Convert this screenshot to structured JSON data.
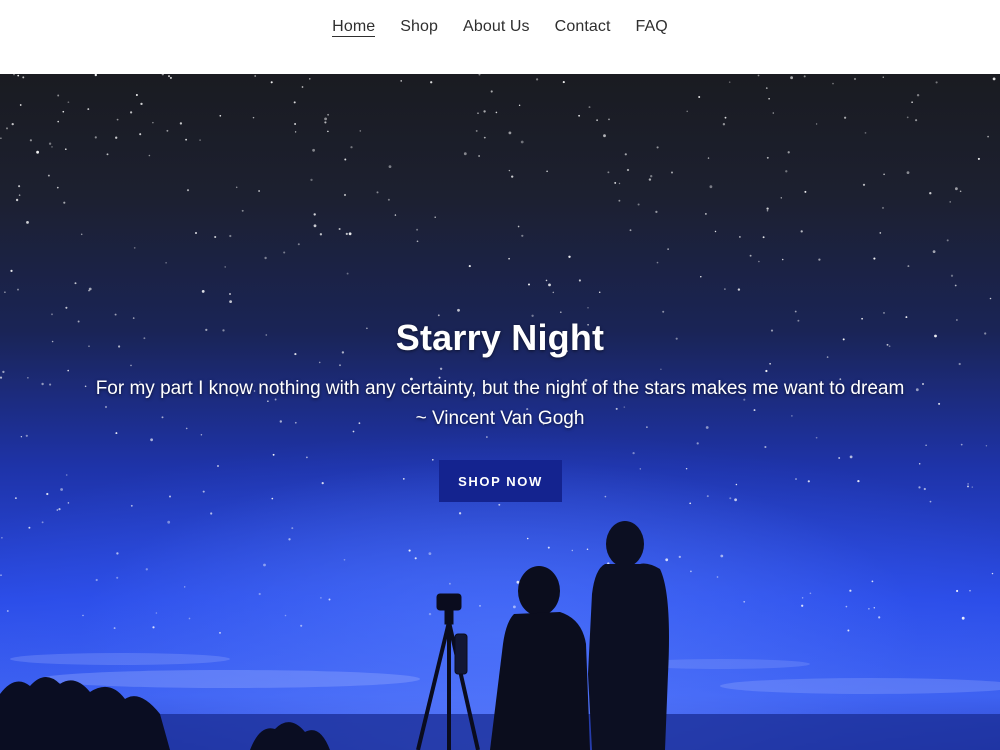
{
  "nav": {
    "items": [
      {
        "label": "Home",
        "active": true
      },
      {
        "label": "Shop",
        "active": false
      },
      {
        "label": "About Us",
        "active": false
      },
      {
        "label": "Contact",
        "active": false
      },
      {
        "label": "FAQ",
        "active": false
      }
    ]
  },
  "hero": {
    "title": "Starry Night",
    "quote": "For my part I know nothing with any certainty, but the night of the stars makes me want to dream",
    "attribution": "~ Vincent Van Gogh",
    "button_label": "SHOP NOW",
    "image_description_icon": "night-sky-stargazers-image"
  },
  "colors": {
    "button_bg": "#14238f",
    "nav_text": "#2f2f2f",
    "sky_dark": "#1a1b21",
    "sky_blue": "#2a4be6"
  }
}
